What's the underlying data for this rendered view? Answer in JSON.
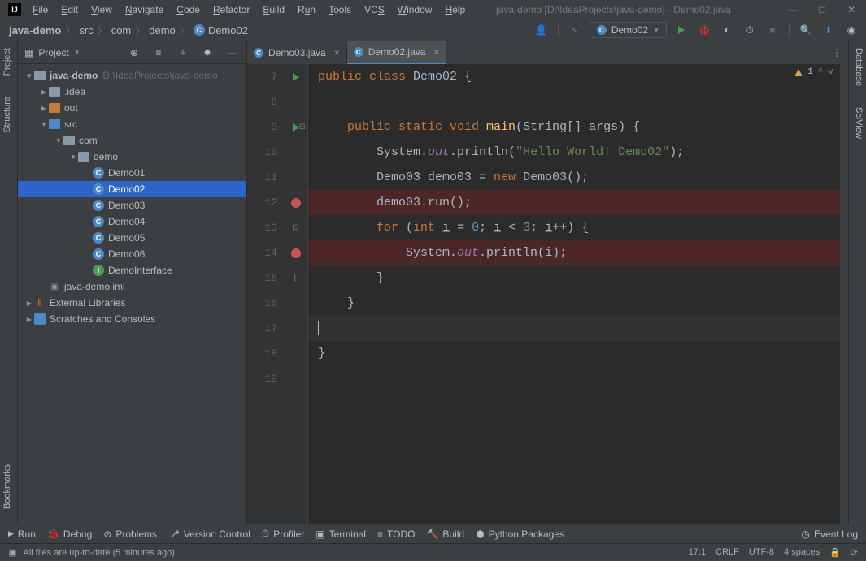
{
  "window_title": "java-demo [D:\\IdeaProjects\\java-demo] - Demo02.java",
  "menu": [
    "File",
    "Edit",
    "View",
    "Navigate",
    "Code",
    "Refactor",
    "Build",
    "Run",
    "Tools",
    "VCS",
    "Window",
    "Help"
  ],
  "breadcrumb": [
    "java-demo",
    "src",
    "com",
    "demo",
    "Demo02"
  ],
  "run_config": "Demo02",
  "project_label": "Project",
  "tree": {
    "root": {
      "name": "java-demo",
      "path": "D:\\IdeaProjects\\java-demo"
    },
    "idea": ".idea",
    "out": "out",
    "src": "src",
    "com": "com",
    "demo": "demo",
    "classes": [
      "Demo01",
      "Demo02",
      "Demo03",
      "Demo04",
      "Demo05",
      "Demo06"
    ],
    "interface": "DemoInterface",
    "iml": "java-demo.iml",
    "ext_lib": "External Libraries",
    "scratch": "Scratches and Consoles"
  },
  "tabs": [
    {
      "name": "Demo03.java",
      "active": false
    },
    {
      "name": "Demo02.java",
      "active": true
    }
  ],
  "inspection_count": "1",
  "line_numbers": [
    "7",
    "8",
    "9",
    "10",
    "11",
    "12",
    "13",
    "14",
    "15",
    "16",
    "17",
    "18",
    "19"
  ],
  "code": {
    "l7": {
      "p1": "public class ",
      "p2": "Demo02 ",
      "p3": "{"
    },
    "l9": {
      "p1": "    ",
      "p2": "public static void ",
      "p3": "main",
      "p4": "(String[] args) {"
    },
    "l10": {
      "p1": "        System.",
      "p2": "out",
      "p3": ".println(",
      "p4": "\"Hello World! Demo02\"",
      "p5": ");"
    },
    "l11": {
      "p1": "        Demo03 demo03 = ",
      "p2": "new ",
      "p3": "Demo03();"
    },
    "l12": {
      "p1": "        demo03.run();"
    },
    "l13": {
      "p1": "        ",
      "p2": "for ",
      "p3": "(",
      "p4": "int ",
      "p5": "i",
      "p6": " = ",
      "p7": "0",
      "p8": "; ",
      "p9": "i",
      "p10": " < ",
      "p11": "3",
      "p12": "; ",
      "p13": "i",
      "p14": "++) {"
    },
    "l14": {
      "p1": "            System.",
      "p2": "out",
      "p3": ".println(",
      "p4": "i",
      "p5": ");"
    },
    "l15": {
      "p1": "        }"
    },
    "l16": {
      "p1": "    }"
    },
    "l18": {
      "p1": "}"
    }
  },
  "bottom_buttons": [
    "Run",
    "Debug",
    "Problems",
    "Version Control",
    "Profiler",
    "Terminal",
    "TODO",
    "Build",
    "Python Packages"
  ],
  "event_log": "Event Log",
  "status_msg": "All files are up-to-date (5 minutes ago)",
  "status_right": {
    "pos": "17:1",
    "le": "CRLF",
    "enc": "UTF-8",
    "indent": "4 spaces"
  },
  "left_tabs": {
    "project": "Project",
    "structure": "Structure",
    "bookmarks": "Bookmarks"
  },
  "right_tabs": {
    "database": "Database",
    "sciview": "SciView"
  }
}
